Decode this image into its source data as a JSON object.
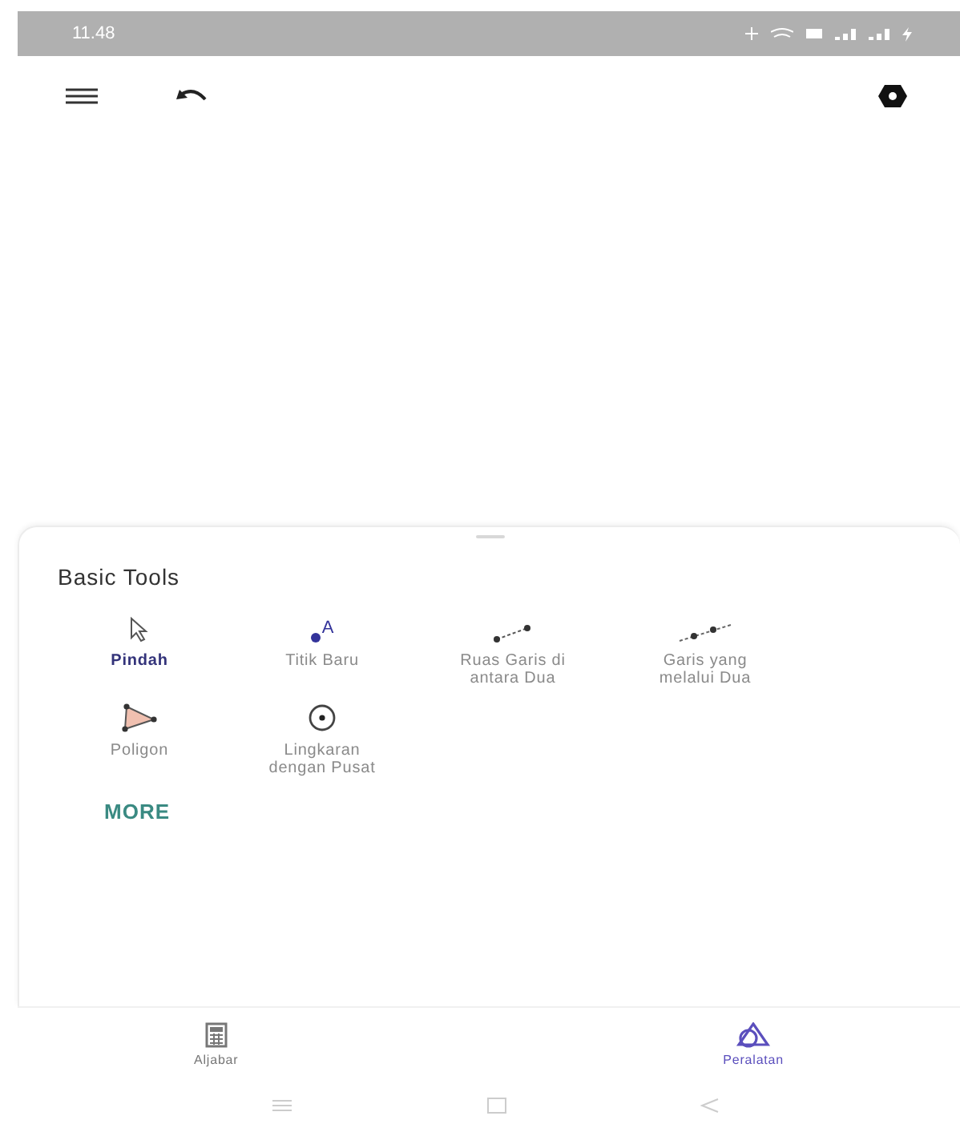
{
  "status_bar": {
    "time": "11.48"
  },
  "panel": {
    "title": "Basic Tools",
    "more": "MORE"
  },
  "tools": [
    {
      "kind": "move",
      "label": "Pindah",
      "selected": true
    },
    {
      "kind": "point",
      "label": "Titik Baru",
      "icon_text": "A",
      "selected": false
    },
    {
      "kind": "segment",
      "label": "Ruas Garis di antara Dua",
      "selected": false
    },
    {
      "kind": "line",
      "label": "Garis yang melalui Dua",
      "selected": false
    },
    {
      "kind": "polygon",
      "label": "Poligon",
      "selected": false
    },
    {
      "kind": "circle",
      "label": "Lingkaran dengan Pusat",
      "selected": false
    }
  ],
  "bottom_nav": [
    {
      "kind": "algebra",
      "label": "Aljabar",
      "selected": false
    },
    {
      "kind": "tools",
      "label": "Peralatan",
      "selected": true
    }
  ]
}
